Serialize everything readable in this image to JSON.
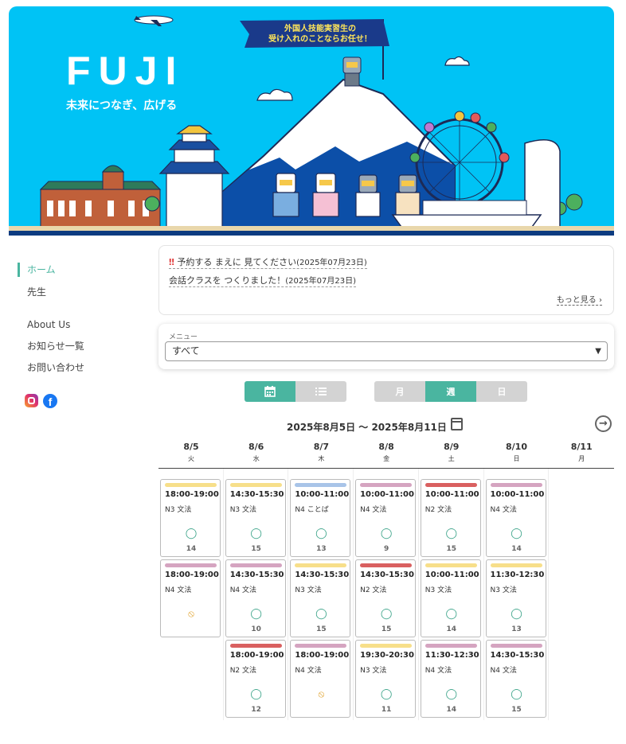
{
  "hero": {
    "title": "FUJI",
    "tagline": "未来につなぎ、広げる",
    "banner_line1": "外国人技能実習生の",
    "banner_line2": "受け入れのことならお任せ！"
  },
  "sidebar": {
    "items": [
      {
        "label": "ホーム",
        "active": true
      },
      {
        "label": "先生"
      },
      {
        "label": "About Us"
      },
      {
        "label": "お知らせ一覧"
      },
      {
        "label": "お問い合わせ"
      }
    ],
    "social": {
      "instagram": "instagram-icon",
      "facebook": "facebook-icon"
    }
  },
  "news": {
    "items": [
      {
        "mark": "‼",
        "title": "予約する まえに 見てください",
        "date": "(2025年07月23日)"
      },
      {
        "mark": "",
        "title": "会話クラスを つくりました！",
        "date": "(2025年07月23日)"
      }
    ],
    "more": "もっと見る"
  },
  "menu": {
    "label": "メニュー",
    "selected": "すべて"
  },
  "view_toggle": {
    "calendar_icon": "calendar-icon",
    "list_icon": "list-icon"
  },
  "period_toggle": {
    "month": "月",
    "week": "週",
    "day": "日",
    "selected": "週"
  },
  "calendar": {
    "range": "2025年8月5日 〜 2025年8月11日",
    "days": [
      {
        "date": "8/5",
        "weekday": "火"
      },
      {
        "date": "8/6",
        "weekday": "水"
      },
      {
        "date": "8/7",
        "weekday": "木"
      },
      {
        "date": "8/8",
        "weekday": "金"
      },
      {
        "date": "8/9",
        "weekday": "土"
      },
      {
        "date": "8/10",
        "weekday": "日"
      },
      {
        "date": "8/11",
        "weekday": "月"
      }
    ],
    "status_symbols": {
      "available": "◯",
      "unavailable": "⃠"
    },
    "lessons": [
      [
        {
          "time": "18:00-19:00",
          "course": "N3 文法",
          "status": "available",
          "seats": "14",
          "color": "#f7df8a"
        },
        {
          "time": "18:00-19:00",
          "course": "N4 文法",
          "status": "unavailable",
          "seats": "",
          "color": "#d5a4c0"
        }
      ],
      [
        {
          "time": "14:30-15:30",
          "course": "N3 文法",
          "status": "available",
          "seats": "15",
          "color": "#f7df8a"
        },
        {
          "time": "14:30-15:30",
          "course": "N4 文法",
          "status": "available",
          "seats": "10",
          "color": "#d5a4c0"
        },
        {
          "time": "18:00-19:00",
          "course": "N2 文法",
          "status": "available",
          "seats": "12",
          "color": "#d96060"
        }
      ],
      [
        {
          "time": "10:00-11:00",
          "course": "N4 ことば",
          "status": "available",
          "seats": "13",
          "color": "#a8c4e8"
        },
        {
          "time": "14:30-15:30",
          "course": "N3 文法",
          "status": "available",
          "seats": "15",
          "color": "#f7df8a"
        },
        {
          "time": "18:00-19:00",
          "course": "N4 文法",
          "status": "unavailable",
          "seats": "",
          "color": "#d5a4c0"
        }
      ],
      [
        {
          "time": "10:00-11:00",
          "course": "N4 文法",
          "status": "available",
          "seats": "9",
          "color": "#d5a4c0"
        },
        {
          "time": "14:30-15:30",
          "course": "N2 文法",
          "status": "available",
          "seats": "15",
          "color": "#d96060"
        },
        {
          "time": "19:30-20:30",
          "course": "N3 文法",
          "status": "available",
          "seats": "11",
          "color": "#f7df8a"
        }
      ],
      [
        {
          "time": "10:00-11:00",
          "course": "N2 文法",
          "status": "available",
          "seats": "15",
          "color": "#d96060"
        },
        {
          "time": "10:00-11:00",
          "course": "N3 文法",
          "status": "available",
          "seats": "14",
          "color": "#f7df8a"
        },
        {
          "time": "11:30-12:30",
          "course": "N4 文法",
          "status": "available",
          "seats": "14",
          "color": "#d5a4c0"
        }
      ],
      [
        {
          "time": "10:00-11:00",
          "course": "N4 文法",
          "status": "available",
          "seats": "14",
          "color": "#d5a4c0"
        },
        {
          "time": "11:30-12:30",
          "course": "N3 文法",
          "status": "available",
          "seats": "13",
          "color": "#f7df8a"
        },
        {
          "time": "14:30-15:30",
          "course": "N4 文法",
          "status": "available",
          "seats": "15",
          "color": "#d5a4c0"
        }
      ],
      []
    ]
  }
}
